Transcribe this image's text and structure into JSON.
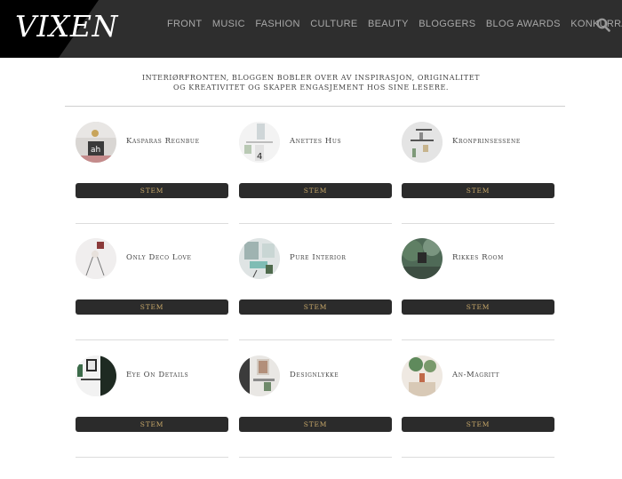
{
  "header": {
    "logo": "VIXEN",
    "nav": [
      "FRONT",
      "MUSIC",
      "FASHION",
      "CULTURE",
      "BEAUTY",
      "BLOGGERS",
      "BLOG AWARDS",
      "KONKURRANSER"
    ],
    "search_icon": "search-icon"
  },
  "intro": {
    "line1": "INTERIØRFRONTEN, BLOGGEN BOBLER OVER AV INSPIRASJON, ORIGINALITET",
    "line2": "OG KREATIVITET OG SKAPER ENGASJEMENT HOS SINE LESERE."
  },
  "vote_label": "STEM",
  "blogs": [
    {
      "name": "Kasparas Regnbue"
    },
    {
      "name": "Anettes Hus"
    },
    {
      "name": "Kronprinsessene"
    },
    {
      "name": "Only Deco Love"
    },
    {
      "name": "Pure Interior"
    },
    {
      "name": "Rikkes Room"
    },
    {
      "name": "Eye On Details"
    },
    {
      "name": "Designlykke"
    },
    {
      "name": "An-Magritt"
    }
  ]
}
